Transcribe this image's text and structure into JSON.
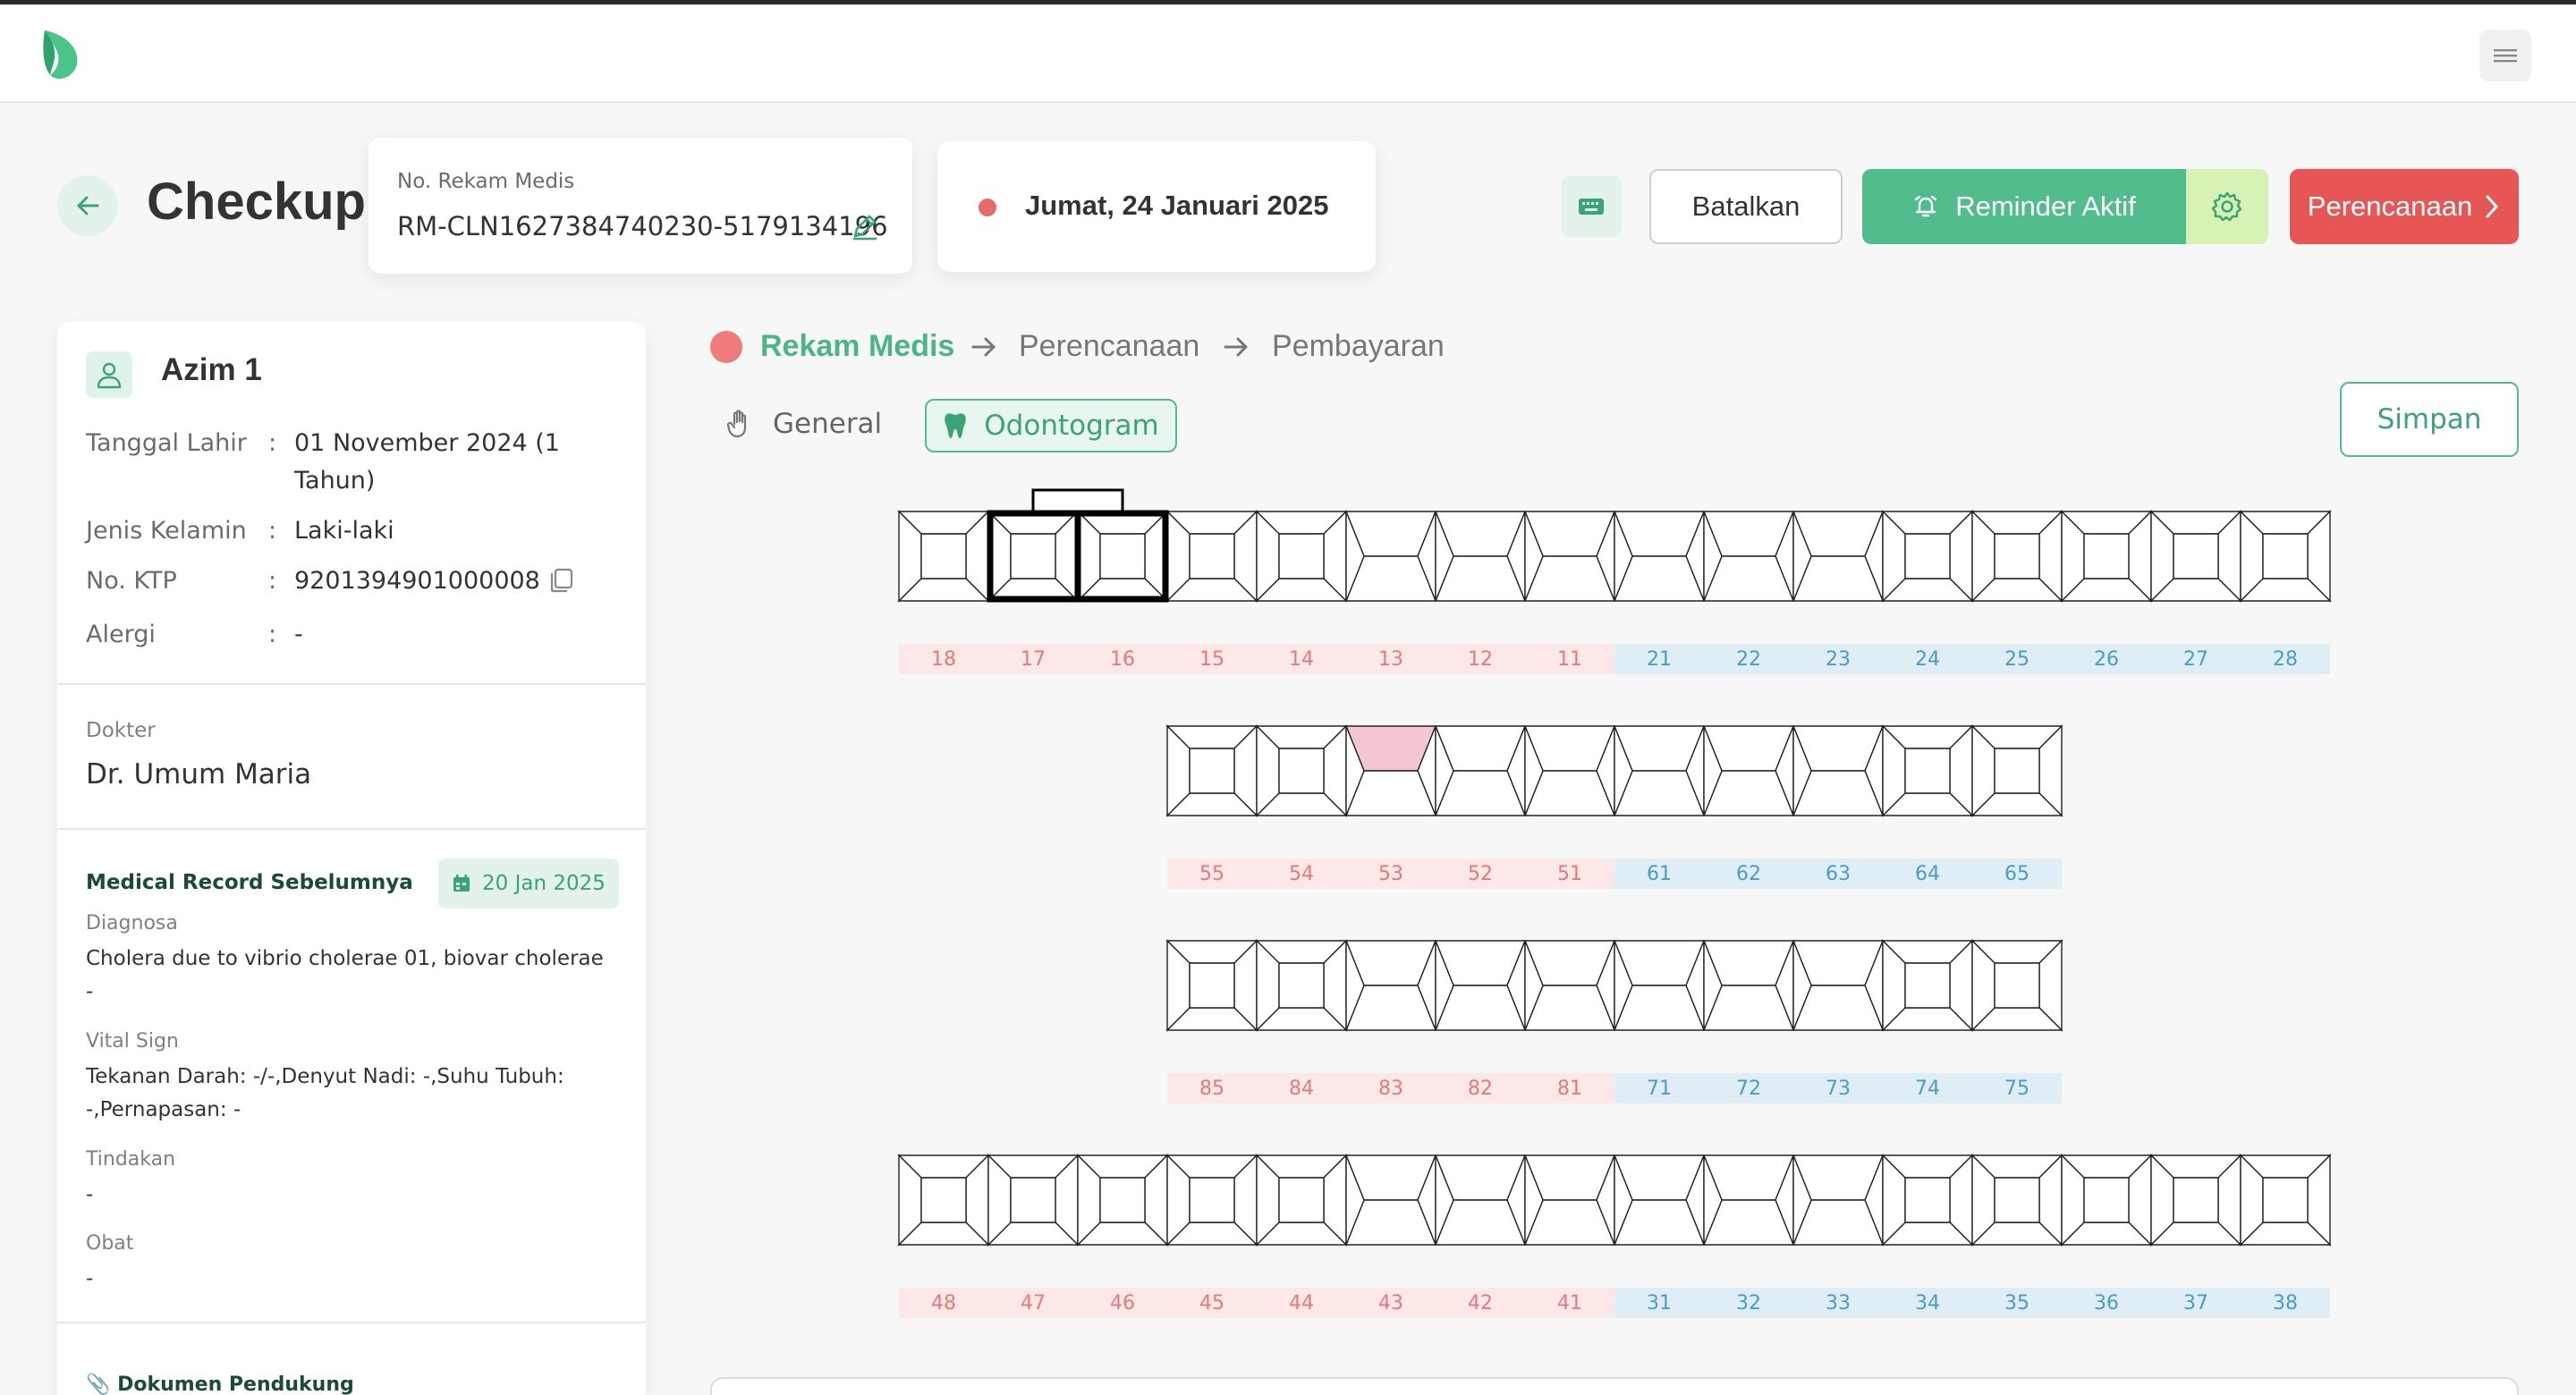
{
  "header": {
    "title": "Checkup",
    "record_label": "No. Rekam Medis",
    "record_number": "RM-CLN1627384740230-5179134196",
    "date": "Jumat, 24 Januari 2025",
    "cancel_label": "Batalkan",
    "reminder_label": "Reminder Aktif",
    "plan_label": "Perencanaan"
  },
  "patient": {
    "name": "Azim 1",
    "fields": [
      {
        "label": "Tanggal Lahir",
        "value": "01 November 2024 (1 Tahun)"
      },
      {
        "label": "Jenis Kelamin",
        "value": "Laki-laki"
      },
      {
        "label": "No. KTP",
        "value": "9201394901000008"
      },
      {
        "label": "Alergi",
        "value": "-"
      }
    ],
    "colon": ":",
    "doctor_label": "Dokter",
    "doctor_name": "Dr. Umum Maria"
  },
  "medical_record": {
    "title": "Medical Record Sebelumnya",
    "date": "20 Jan 2025",
    "diagnosis_label": "Diagnosa",
    "diagnosis_text": "Cholera due to vibrio cholerae 01, biovar cholerae",
    "diagnosis_extra": "-",
    "vital_label": "Vital Sign",
    "vital_text": "Tekanan Darah: -/-,Denyut Nadi: -,Suhu Tubuh: -,Pernapasan: -",
    "action_label": "Tindakan",
    "action_text": "-",
    "medicine_label": "Obat",
    "medicine_text": "-",
    "support_docs_label": "Dokumen Pendukung"
  },
  "steps": [
    "Rekam Medis",
    "Perencanaan",
    "Pembayaran"
  ],
  "tabs": {
    "general": "General",
    "odontogram": "Odontogram"
  },
  "save_label": "Simpan",
  "odontogram": {
    "rows": [
      {
        "red": [
          "18",
          "17",
          "16",
          "15",
          "14",
          "13",
          "12",
          "11"
        ],
        "blue": [
          "21",
          "22",
          "23",
          "24",
          "25",
          "26",
          "27",
          "28"
        ],
        "shape": "molar"
      },
      {
        "red": [
          "55",
          "54",
          "53",
          "52",
          "51"
        ],
        "blue": [
          "61",
          "62",
          "63",
          "64",
          "65"
        ],
        "shape": "primary"
      },
      {
        "red": [
          "85",
          "84",
          "83",
          "82",
          "81"
        ],
        "blue": [
          "71",
          "72",
          "73",
          "74",
          "75"
        ],
        "shape": "primary"
      },
      {
        "red": [
          "48",
          "47",
          "46",
          "45",
          "44",
          "43",
          "42",
          "41"
        ],
        "blue": [
          "31",
          "32",
          "33",
          "34",
          "35",
          "36",
          "37",
          "38"
        ],
        "shape": "molar"
      }
    ],
    "highlight_color": "#f4c6d0"
  },
  "colors": {
    "primary": "#52bd8c",
    "danger": "#e85555",
    "lime": "#d8f2b6"
  }
}
